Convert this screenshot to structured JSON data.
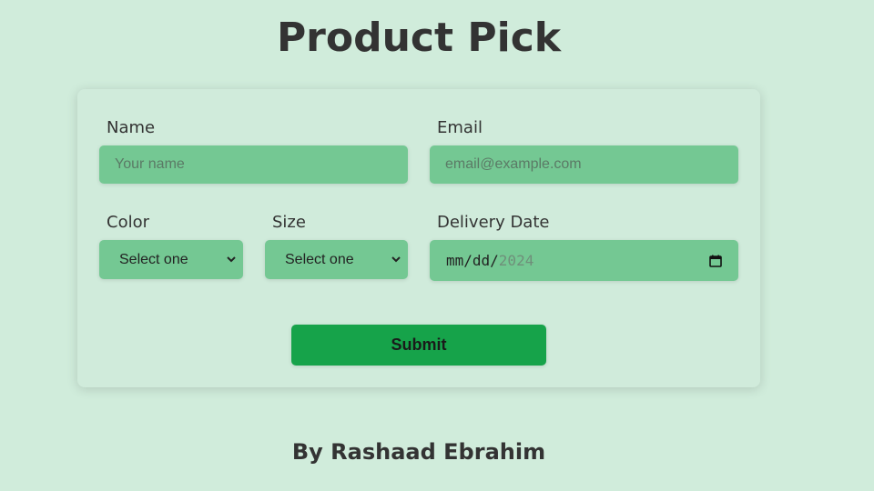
{
  "header": {
    "title": "Product Pick"
  },
  "form": {
    "name": {
      "label": "Name",
      "placeholder": "Your name",
      "value": ""
    },
    "email": {
      "label": "Email",
      "placeholder": "email@example.com",
      "value": ""
    },
    "color": {
      "label": "Color",
      "selected": "Select one"
    },
    "size": {
      "label": "Size",
      "selected": "Select one"
    },
    "delivery_date": {
      "label": "Delivery Date",
      "display_prefix": "mm/dd/",
      "display_year": "2024"
    },
    "submit_label": "Submit"
  },
  "footer": {
    "credit": "By Rashaad Ebrahim"
  },
  "colors": {
    "background": "#d0ecdb",
    "field": "#74c893",
    "button": "#16a34a",
    "text": "#333333"
  },
  "icons": {
    "date": "calendar-icon",
    "select": "chevron-down-icon"
  }
}
